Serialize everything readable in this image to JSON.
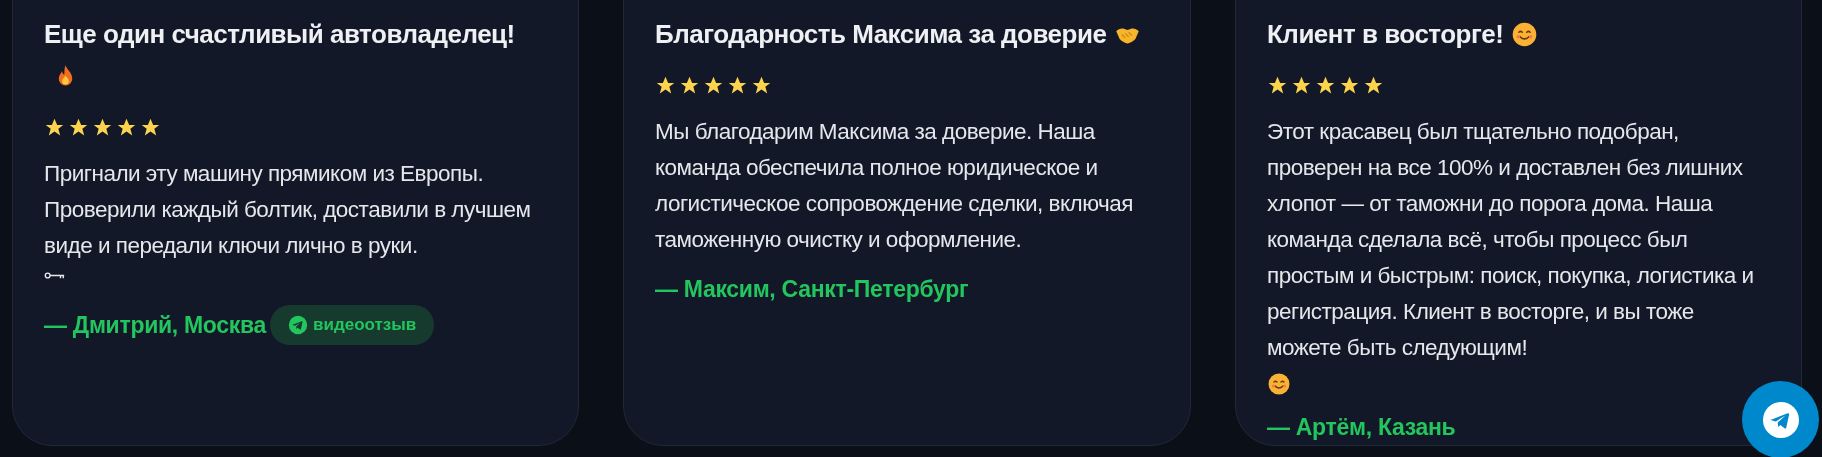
{
  "reviews": [
    {
      "title": "Еще один счастливый автовладелец!",
      "stars": 5,
      "text": "Пригнали эту машину прямиком из Европы. Проверили каждый болтик, доставили в лучшем виде и передали ключи лично в руки.",
      "author": "— Дмитрий, Москва",
      "badge": "видеоотзыв"
    },
    {
      "title": "Благодарность Максима за доверие",
      "stars": 5,
      "text": "Мы благодарим Максима за доверие. Наша команда обеспечила полное юридическое и логистическое сопровождение сделки, включая таможенную очистку и оформление.",
      "author": "— Максим, Санкт-Петербург"
    },
    {
      "title": "Клиент в восторге!",
      "stars": 5,
      "text": "Этот красавец был тщательно подобран, проверен на все 100% и доставлен без лишних хлопот — от таможни до порога дома. Наша команда сделала всё, чтобы процесс был простым и быстрым: поиск, покупка, логистика и регистрация. Клиент в восторге, и вы тоже можете быть следующим!",
      "author": "— Артём, Казань"
    }
  ]
}
